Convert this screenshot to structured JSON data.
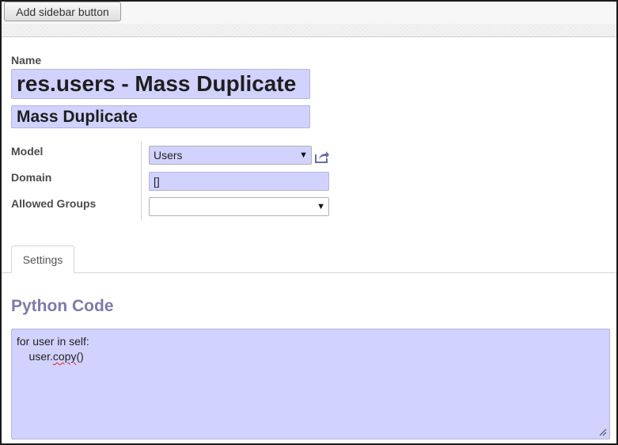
{
  "toolbar": {
    "add_sidebar_label": "Add sidebar button"
  },
  "form": {
    "name_label": "Name",
    "name_value": "res.users - Mass Duplicate",
    "subtitle_value": "Mass Duplicate",
    "model_label": "Model",
    "model_value": "Users",
    "domain_label": "Domain",
    "domain_value": "[]",
    "groups_label": "Allowed Groups",
    "groups_value": ""
  },
  "tabs": [
    {
      "label": "Settings"
    }
  ],
  "settings": {
    "section_title": "Python Code",
    "code_lines": {
      "line1": "for user in self:",
      "line2_indent": "    user.",
      "line2_word": "copy",
      "line2_tail": "()"
    }
  },
  "icons": {
    "external_link": "external-link-icon",
    "dropdown": "dropdown-arrow-icon",
    "resize": "resize-grip-icon"
  },
  "colors": {
    "field_bg": "#d2d2ff",
    "section_title": "#7c7bad",
    "label": "#4c4c4c"
  }
}
